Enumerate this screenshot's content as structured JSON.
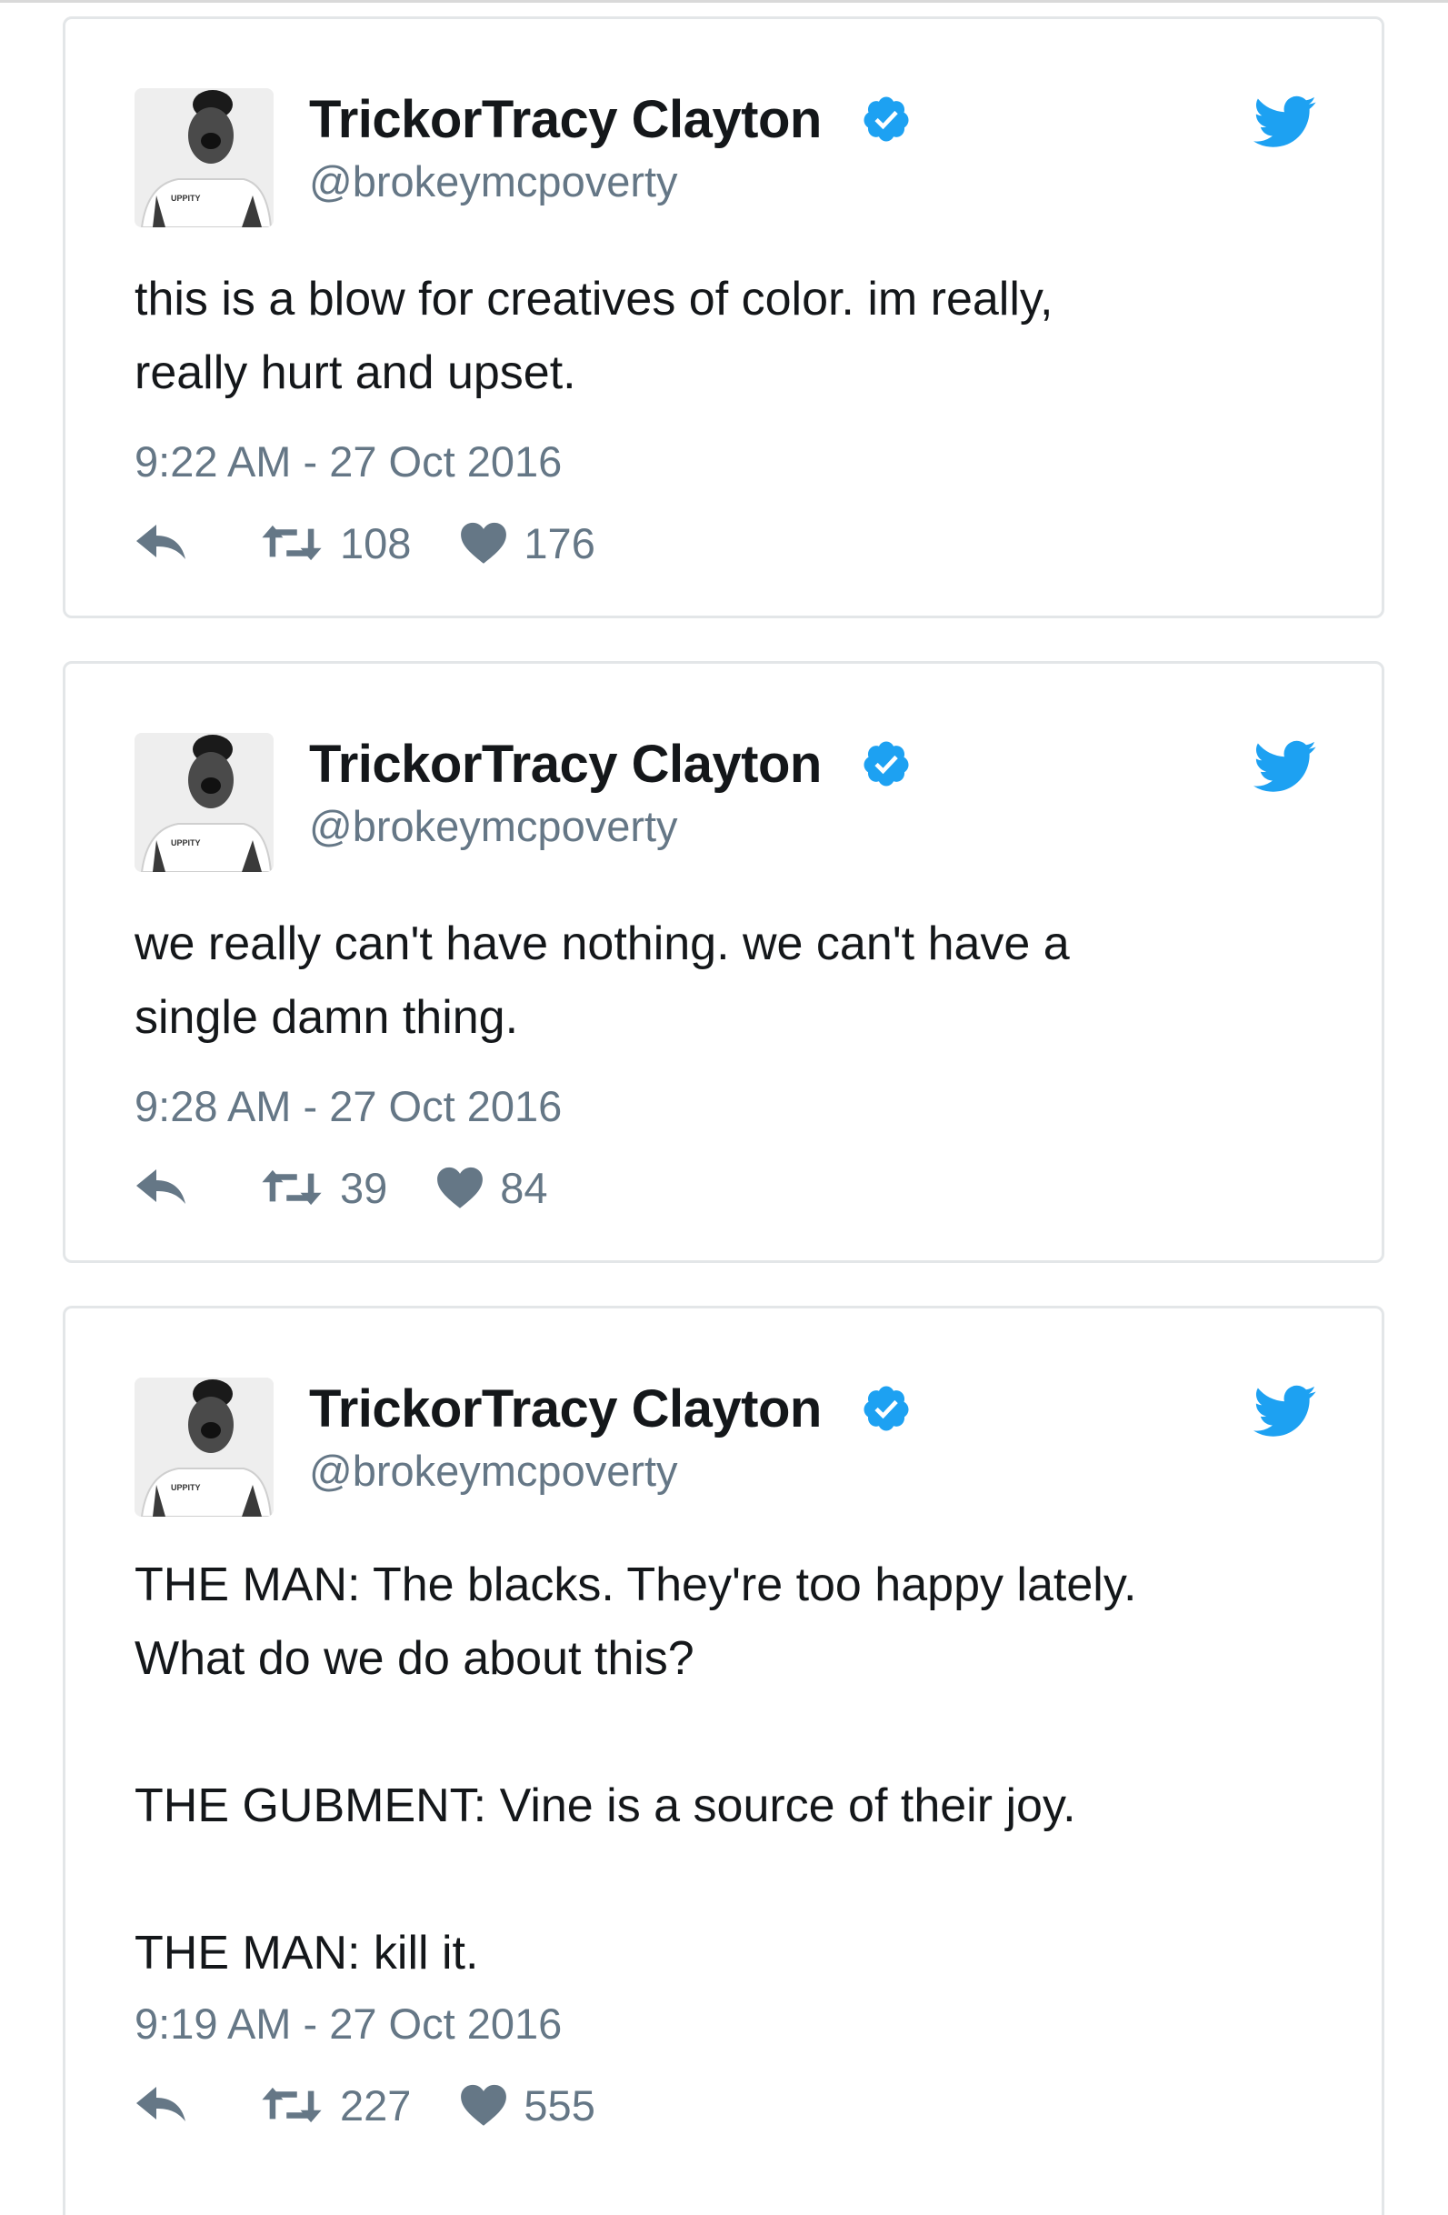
{
  "colors": {
    "text": "#14171a",
    "secondary": "#657786",
    "border": "#e3e6e8",
    "twitter_blue": "#1da1f2",
    "verified_blue": "#1da1f2"
  },
  "tweets": [
    {
      "display_name": "TrickorTracy Clayton",
      "handle": "@brokeymcpoverty",
      "text": "this is a blow for creatives of color. im really,\nreally hurt and upset.",
      "timestamp": "9:22 AM - 27 Oct 2016",
      "retweets": "108",
      "likes": "176",
      "avatar_shirt_text": "UPPITY",
      "icons": {
        "reply": "reply-icon",
        "retweet": "retweet-icon",
        "like": "heart-icon",
        "brand": "twitter-bird-icon",
        "verified": "verified-badge-icon"
      }
    },
    {
      "display_name": "TrickorTracy Clayton",
      "handle": "@brokeymcpoverty",
      "text": "we really can't have nothing. we can't have a\nsingle damn thing.",
      "timestamp": "9:28 AM - 27 Oct 2016",
      "retweets": "39",
      "likes": "84",
      "avatar_shirt_text": "UPPITY",
      "icons": {
        "reply": "reply-icon",
        "retweet": "retweet-icon",
        "like": "heart-icon",
        "brand": "twitter-bird-icon",
        "verified": "verified-badge-icon"
      }
    },
    {
      "display_name": "TrickorTracy Clayton",
      "handle": "@brokeymcpoverty",
      "text": "THE MAN: The blacks. They're too happy lately.\nWhat do we do about this?\n\nTHE GUBMENT: Vine is a source of their joy.\n\nTHE MAN: kill it.",
      "timestamp": "9:19 AM - 27 Oct 2016",
      "retweets": "227",
      "likes": "555",
      "avatar_shirt_text": "UPPITY",
      "icons": {
        "reply": "reply-icon",
        "retweet": "retweet-icon",
        "like": "heart-icon",
        "brand": "twitter-bird-icon",
        "verified": "verified-badge-icon"
      }
    }
  ]
}
